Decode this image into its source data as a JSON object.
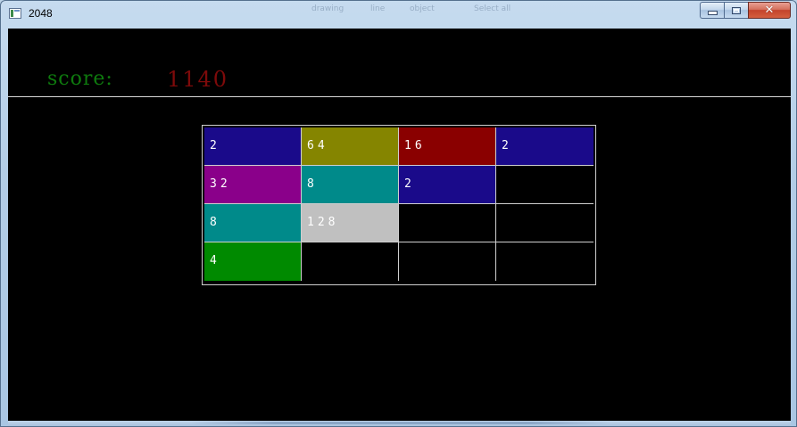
{
  "window": {
    "title": "2048",
    "background_menu": [
      "drawing",
      "line",
      "object",
      "Select all"
    ],
    "buttons": {
      "minimize": "minimize",
      "maximize": "maximize",
      "close": "✕"
    }
  },
  "scoreboard": {
    "label": "score:",
    "value": "1140",
    "label_color": "#0e7a0e",
    "value_color": "#7d0a0a"
  },
  "board": {
    "rows": 4,
    "cols": 4,
    "tiles": [
      {
        "value": "2",
        "color": "#1a0a8a"
      },
      {
        "value": "64",
        "color": "#858500"
      },
      {
        "value": "16",
        "color": "#8a0000"
      },
      {
        "value": "2",
        "color": "#1a0a8a"
      },
      {
        "value": "32",
        "color": "#8a008a"
      },
      {
        "value": "8",
        "color": "#008a8a"
      },
      {
        "value": "2",
        "color": "#1a0a8a"
      },
      {
        "value": "",
        "color": "#000000"
      },
      {
        "value": "8",
        "color": "#008a8a"
      },
      {
        "value": "128",
        "color": "#c0c0c0"
      },
      {
        "value": "",
        "color": "#000000"
      },
      {
        "value": "",
        "color": "#000000"
      },
      {
        "value": "4",
        "color": "#008a00"
      },
      {
        "value": "",
        "color": "#000000"
      },
      {
        "value": "",
        "color": "#000000"
      },
      {
        "value": "",
        "color": "#000000"
      }
    ]
  }
}
